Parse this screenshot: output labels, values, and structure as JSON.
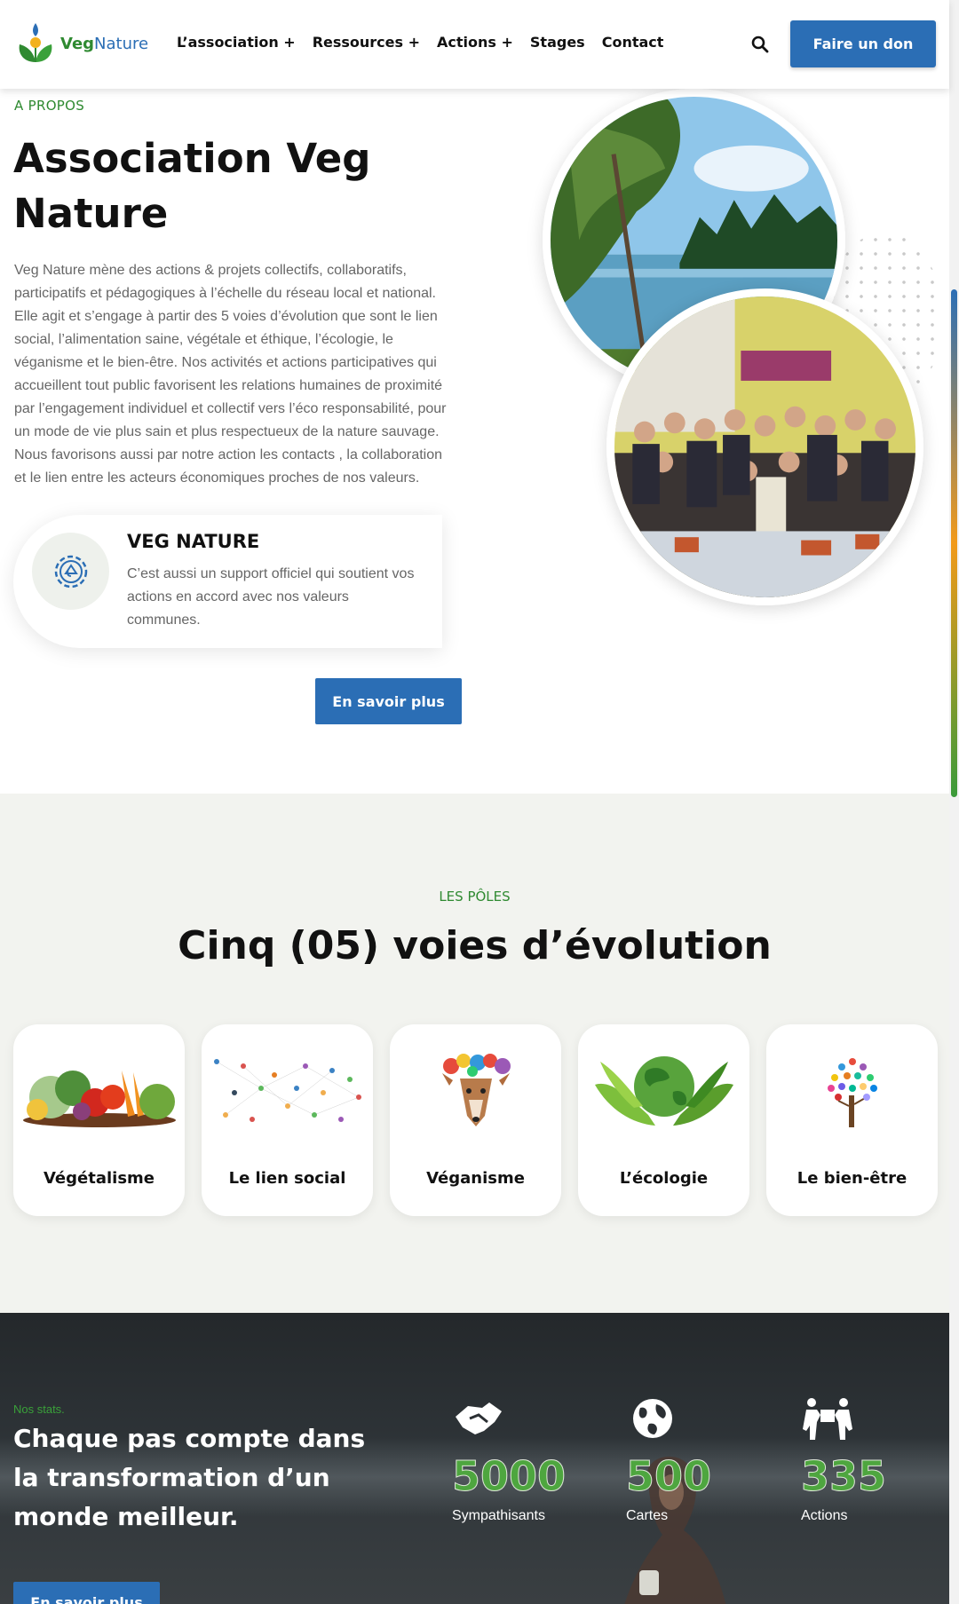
{
  "header": {
    "logo": {
      "part1": "Veg",
      "part2": "Nature"
    },
    "nav": [
      {
        "label": "L’association +"
      },
      {
        "label": "Ressources +"
      },
      {
        "label": "Actions +"
      },
      {
        "label": "Stages"
      },
      {
        "label": "Contact"
      }
    ],
    "search_icon": "search-icon",
    "donate_label": "Faire un don"
  },
  "about": {
    "eyebrow": "A PROPOS",
    "title": "Association Veg Nature",
    "text": "Veg Nature mène des actions & projets collectifs, collaboratifs, participatifs et pédagogiques à l’échelle du réseau local et national. Elle agit et s’engage à partir des 5 voies d’évolution que sont le lien social, l’alimentation saine, végétale et éthique, l’écologie, le véganisme et le bien-être. Nos activités et actions participatives qui accueillent tout public favorisent les relations humaines de proximité par l’engagement individuel et collectif vers l’éco responsabilité, pour un mode de vie plus sain et plus respectueux de la nature sauvage. Nous favorisons aussi par notre action les contacts , la collaboration et le lien entre les acteurs économiques proches de nos valeurs.",
    "feature": {
      "icon": "gear-recycle-icon",
      "title": "VEG NATURE",
      "text": "C’est aussi un support officiel qui soutient vos actions en accord avec nos valeurs communes."
    },
    "button_label": "En savoir plus"
  },
  "poles": {
    "eyebrow": "LES PÔLES",
    "title": "Cinq (05) voies d’évolution",
    "items": [
      {
        "label": "Végétalisme",
        "icon": "vegetables-image"
      },
      {
        "label": "Le lien social",
        "icon": "social-network-image"
      },
      {
        "label": "Véganisme",
        "icon": "deer-image"
      },
      {
        "label": "L’écologie",
        "icon": "earth-hands-image"
      },
      {
        "label": "Le bien-être",
        "icon": "butterfly-tree-image"
      }
    ]
  },
  "stats": {
    "eyebrow": "Nos stats.",
    "title": "Chaque pas compte dans la transformation d’un monde meilleur.",
    "button_label": "En savoir plus",
    "items": [
      {
        "value": "5000",
        "label": "Sympathisants",
        "icon": "handshake-icon"
      },
      {
        "value": "500",
        "label": "Cartes",
        "icon": "globe-icon"
      },
      {
        "value": "335",
        "label": "Actions",
        "icon": "people-carry-icon"
      }
    ]
  },
  "colors": {
    "brand_green": "#2f8a31",
    "brand_blue": "#2b6eb5",
    "stat_green": "#4ea63f",
    "section_bg": "#f2f3ef"
  }
}
